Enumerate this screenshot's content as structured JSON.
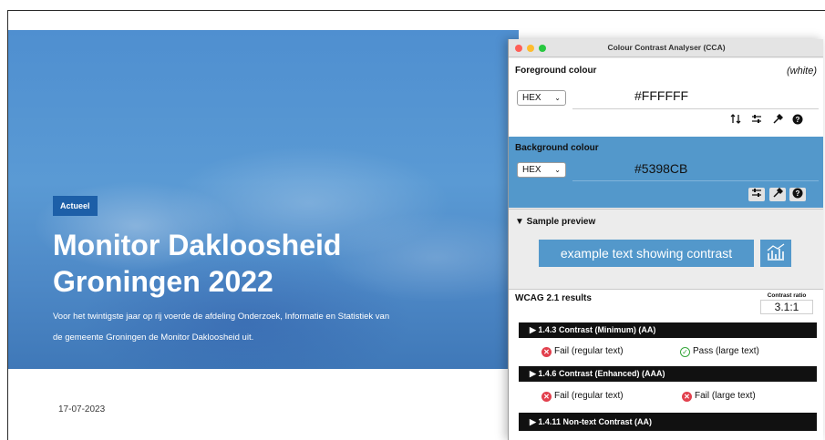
{
  "website": {
    "badge": "Actueel",
    "title_line1": "Monitor Dakloosheid",
    "title_line2": "Groningen 2022",
    "desc_line1": "Voor het twintigste jaar op rij voerde de afdeling Onderzoek, Informatie en Statistiek van",
    "desc_line2": "de gemeente Groningen de Monitor Dakloosheid uit.",
    "date": "17-07-2023"
  },
  "window": {
    "title": "Colour Contrast Analyser (CCA)"
  },
  "foreground": {
    "label": "Foreground colour",
    "name": "(white)",
    "format": "HEX",
    "value": "#FFFFFF",
    "color": "#FFFFFF"
  },
  "background": {
    "label": "Background colour",
    "format": "HEX",
    "value": "#5398CB",
    "color": "#5398CB"
  },
  "preview": {
    "label": "▼ Sample preview",
    "sample_text": "example text showing contrast",
    "icon": "chart-contrast-icon"
  },
  "results": {
    "label": "WCAG 2.1 results",
    "contrast_ratio_label": "Contrast ratio",
    "contrast_ratio": "3.1:1",
    "criteria": [
      {
        "title": "▶  1.4.3 Contrast (Minimum) (AA)",
        "regular": "Fail (regular text)",
        "large": "Pass (large text)",
        "regular_status": "fail",
        "large_status": "pass"
      },
      {
        "title": "▶  1.4.6 Contrast (Enhanced) (AAA)",
        "regular": "Fail (regular text)",
        "large": "Fail (large text)",
        "regular_status": "fail",
        "large_status": "fail"
      },
      {
        "title": "▶  1.4.11 Non-text Contrast (AA)"
      }
    ]
  },
  "toolbar": {
    "swap_icon": "swap-icon",
    "sliders_icon": "sliders-icon",
    "picker_icon": "eyedropper-icon",
    "help_icon": "help-icon"
  },
  "colors": {
    "hero_blue": "#4f8fd0",
    "badge_blue": "#1d5fa8",
    "fail": "#e2404d",
    "pass": "#35a63a"
  }
}
